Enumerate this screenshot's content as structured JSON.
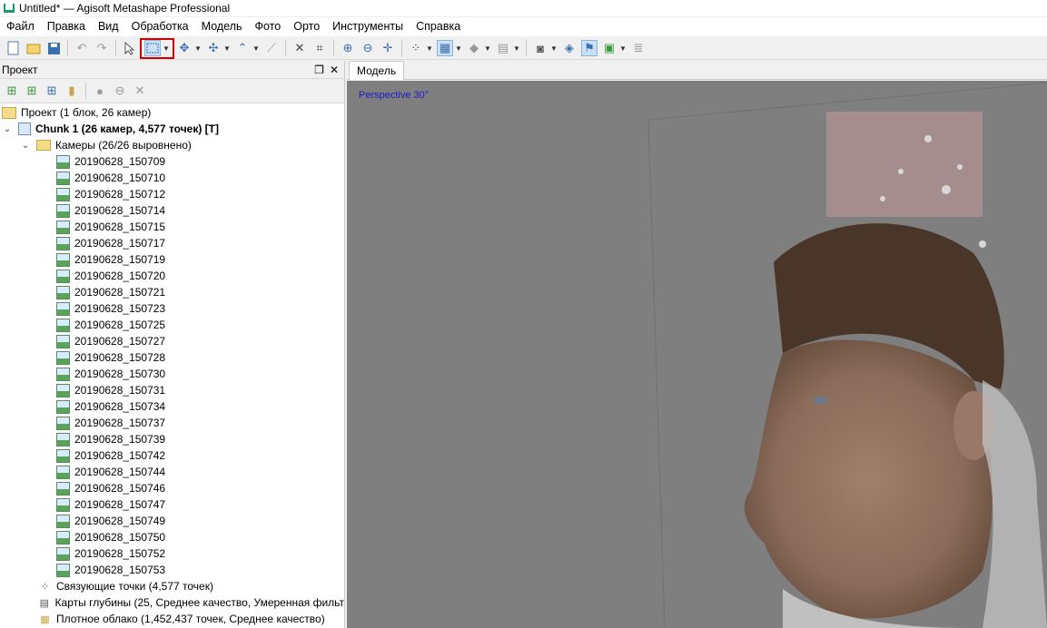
{
  "window": {
    "title": "Untitled* — Agisoft Metashape Professional"
  },
  "menu": [
    "Файл",
    "Правка",
    "Вид",
    "Обработка",
    "Модель",
    "Фото",
    "Орто",
    "Инструменты",
    "Справка"
  ],
  "toolbar": {
    "icons": [
      "new-icon",
      "open-icon",
      "save-icon",
      "undo-icon",
      "redo-icon",
      "pointer-icon",
      "rectangle-selection-icon",
      "navigation-icon",
      "move-icon",
      "ruler-icon",
      "measure-icon",
      "delete-icon",
      "crop-icon",
      "zoom-in-icon",
      "zoom-out-icon",
      "move-view-icon",
      "points-icon",
      "dense-cloud-icon",
      "shading-icon",
      "tiles-icon",
      "camera-icon",
      "markers-icon",
      "flag-icon",
      "image-icon",
      "layers-icon"
    ],
    "highlighted": "rectangle-selection-icon"
  },
  "project_panel": {
    "title": "Проект",
    "tree": {
      "project": "Проект (1 блок, 26 камер)",
      "chunk": "Chunk 1 (26 камер, 4,577 точек) [T]",
      "cameras_folder": "Камеры (26/26 выровнено)",
      "cameras": [
        "20190628_150709",
        "20190628_150710",
        "20190628_150712",
        "20190628_150714",
        "20190628_150715",
        "20190628_150717",
        "20190628_150719",
        "20190628_150720",
        "20190628_150721",
        "20190628_150723",
        "20190628_150725",
        "20190628_150727",
        "20190628_150728",
        "20190628_150730",
        "20190628_150731",
        "20190628_150734",
        "20190628_150737",
        "20190628_150739",
        "20190628_150742",
        "20190628_150744",
        "20190628_150746",
        "20190628_150747",
        "20190628_150749",
        "20190628_150750",
        "20190628_150752",
        "20190628_150753"
      ],
      "tie_points": "Связующие точки (4,577 точек)",
      "depth_maps": "Карты глубины (25, Среднее качество, Умеренная фильт",
      "dense_cloud": "Плотное облако (1,452,437 точек, Среднее качество)"
    }
  },
  "viewport": {
    "tab": "Модель",
    "projection": "Perspective 30°"
  },
  "colors": {
    "viewport_bg": "#7f7f7f",
    "highlight": "#d00000",
    "projection_text": "#1a1acc"
  }
}
